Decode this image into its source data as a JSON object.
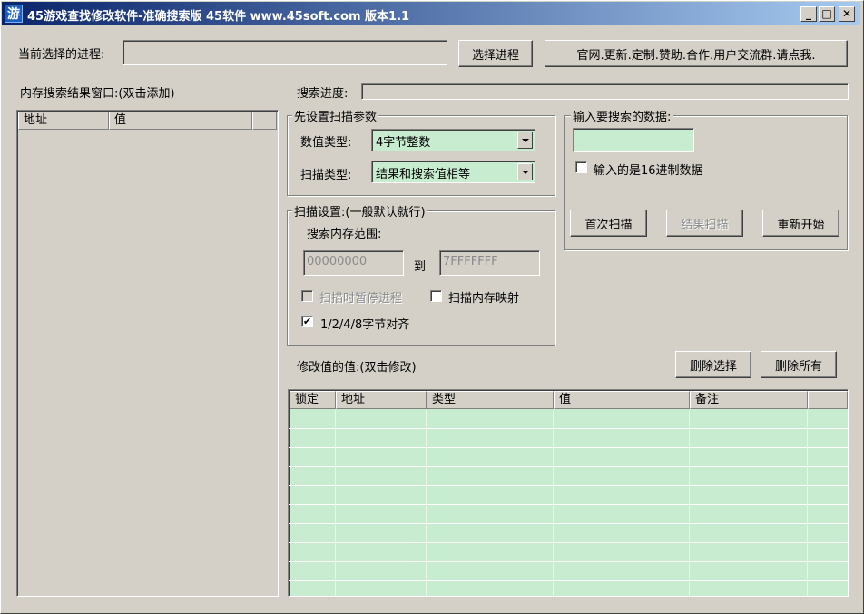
{
  "window": {
    "title": "45游戏查找修改软件-准确搜索版 45软件 www.45soft.com 版本1.1",
    "icon_text": "游",
    "controls": [
      "_",
      "□",
      "✕"
    ]
  },
  "process": {
    "label": "当前选择的进程:",
    "value": "",
    "select_button": "选择进程",
    "website_button": "官网.更新.定制.赞助.合作.用户交流群.请点我."
  },
  "results": {
    "label": "内存搜索结果窗口:(双击添加)",
    "columns": [
      "地址",
      "值"
    ],
    "rows": []
  },
  "progress": {
    "label": "搜索进度:",
    "value": 0
  },
  "scan_params": {
    "title": "先设置扫描参数",
    "value_type_label": "数值类型:",
    "value_type": "4字节整数",
    "scan_type_label": "扫描类型:",
    "scan_type": "结果和搜索值相等"
  },
  "search_input": {
    "title": "输入要搜索的数据:",
    "value": "",
    "hex_label": "输入的是16进制数据",
    "hex_checked": false,
    "first_scan": "首次扫描",
    "next_scan": "结果扫描",
    "restart": "重新开始"
  },
  "scan_settings": {
    "title": "扫描设置:(一般默认就行)",
    "range_label": "搜索内存范围:",
    "range_from": "00000000",
    "to_label": "到",
    "range_to": "7FFFFFFF",
    "pause_label": "扫描时暂停进程",
    "pause_checked": false,
    "mapped_label": "扫描内存映射",
    "mapped_checked": false,
    "align_label": "1/2/4/8字节对齐",
    "align_checked": true
  },
  "modify": {
    "label": "修改值的值:(双击修改)",
    "delete_selected": "删除选择",
    "delete_all": "删除所有",
    "columns": [
      "锁定",
      "地址",
      "类型",
      "值",
      "备注"
    ],
    "rows": []
  },
  "colors": {
    "title_start": "#0a246a",
    "title_end": "#a6caf0",
    "face": "#d4d0c8",
    "input_green": "#c8ecd0"
  }
}
